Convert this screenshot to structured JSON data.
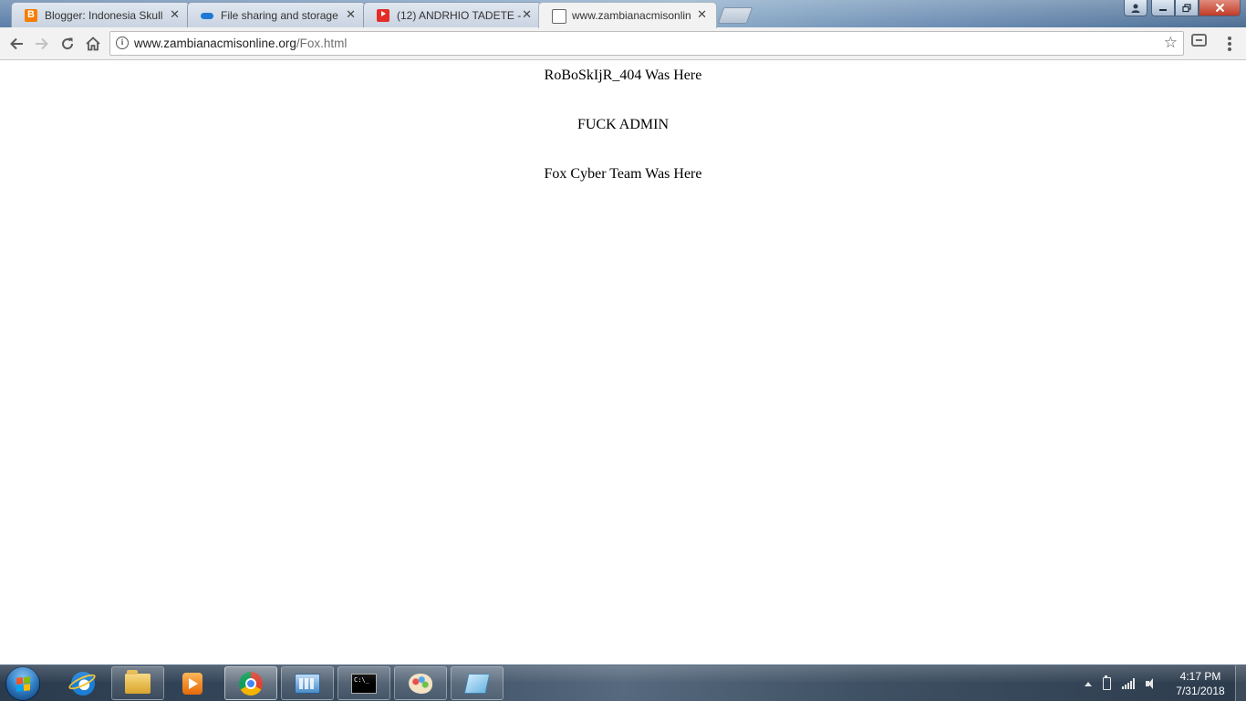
{
  "browser": {
    "tabs": [
      {
        "title": "Blogger: Indonesia Skull",
        "icon": "blogger-icon",
        "active": false
      },
      {
        "title": "File sharing and storage",
        "icon": "cloud-icon",
        "active": false
      },
      {
        "title": "(12) ANDRHIO TADETE -",
        "icon": "youtube-icon",
        "active": false
      },
      {
        "title": "www.zambianacmisonlin",
        "icon": "document-icon",
        "active": true
      }
    ],
    "close_glyph": "✕",
    "address": {
      "host": "www.zambianacmisonline.org",
      "path": "/Fox.html"
    }
  },
  "page": {
    "lines": [
      "RoBoSkIjR_404 Was Here",
      "FUCK ADMIN",
      "Fox Cyber Team Was Here"
    ]
  },
  "taskbar": {
    "apps": [
      {
        "name": "internet-explorer-icon",
        "state": "pinned"
      },
      {
        "name": "file-explorer-icon",
        "state": "running"
      },
      {
        "name": "media-player-icon",
        "state": "pinned"
      },
      {
        "name": "chrome-icon",
        "state": "active"
      },
      {
        "name": "control-panel-icon",
        "state": "running"
      },
      {
        "name": "command-prompt-icon",
        "state": "running"
      },
      {
        "name": "paint-icon",
        "state": "running"
      },
      {
        "name": "notepad-icon",
        "state": "running"
      }
    ],
    "clock": {
      "time": "4:17 PM",
      "date": "7/31/2018"
    }
  },
  "colors": {
    "accent_close": "#c23b26",
    "page_bg": "#ffffff",
    "text": "#000000"
  }
}
